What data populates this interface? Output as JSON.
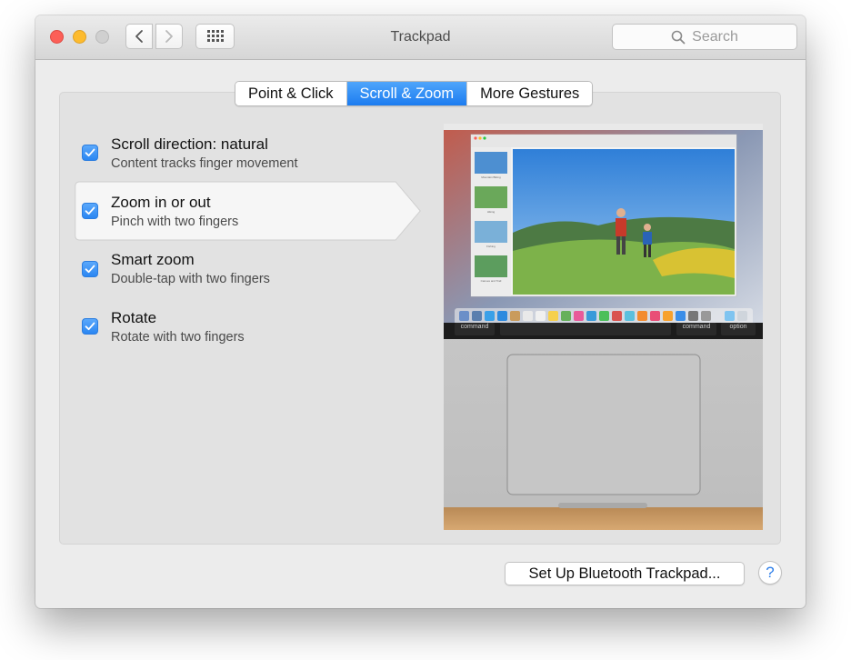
{
  "window": {
    "title": "Trackpad"
  },
  "toolbar": {
    "back_icon": "chevron-left-icon",
    "forward_icon": "chevron-right-icon",
    "grid_icon": "grid-icon"
  },
  "search": {
    "placeholder": "Search",
    "icon": "search-icon"
  },
  "tabs": [
    {
      "label": "Point & Click",
      "active": false
    },
    {
      "label": "Scroll & Zoom",
      "active": true
    },
    {
      "label": "More Gestures",
      "active": false
    }
  ],
  "options": [
    {
      "title": "Scroll direction: natural",
      "subtitle": "Content tracks finger movement",
      "checked": true,
      "selected": false
    },
    {
      "title": "Zoom in or out",
      "subtitle": "Pinch with two fingers",
      "checked": true,
      "selected": true
    },
    {
      "title": "Smart zoom",
      "subtitle": "Double-tap with two fingers",
      "checked": true,
      "selected": false
    },
    {
      "title": "Rotate",
      "subtitle": "Rotate with two fingers",
      "checked": true,
      "selected": false
    }
  ],
  "preview": {
    "keys": {
      "left": "command",
      "right": "command",
      "far_right": "option"
    },
    "sidebar_labels": [
      "Mountain Biking",
      "Hiking",
      "Fishing",
      "Canoes and Trail"
    ]
  },
  "footer": {
    "setup_button": "Set Up Bluetooth Trackpad...",
    "help_label": "?"
  },
  "colors": {
    "accent": "#2a86f2",
    "close": "#fc5f57",
    "minimize": "#fdbb2e"
  }
}
